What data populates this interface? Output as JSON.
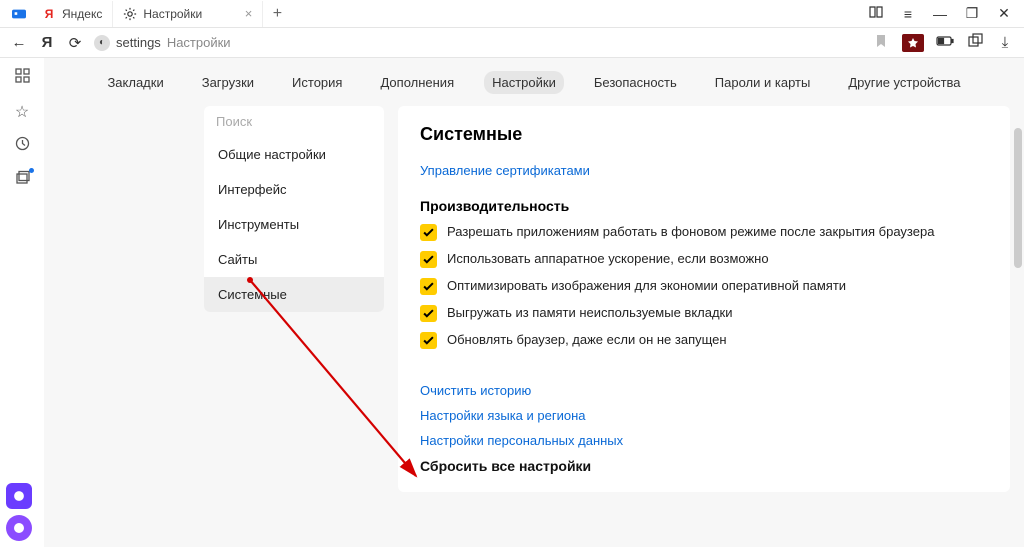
{
  "tabs": [
    {
      "label": "Яндекс",
      "icon": "Я",
      "icon_color": "#e52620"
    },
    {
      "label": "Настройки",
      "icon": "gear"
    }
  ],
  "window_controls": {
    "reader": "⧁",
    "menu": "≡",
    "min": "—",
    "max": "❐",
    "close": "✕"
  },
  "toolbar": {
    "back": "←",
    "home_letter": "Я",
    "reload": "⟳",
    "lock_icon": "◐",
    "addr_prefix": "settings",
    "addr_rest": "Настройки",
    "bookmark": "⚑",
    "battery": "▭",
    "ext": "⧉",
    "download": "⤓"
  },
  "leftrail": [
    "⊞",
    "☆",
    "◷",
    "⧉"
  ],
  "subnav": [
    "Закладки",
    "Загрузки",
    "История",
    "Дополнения",
    "Настройки",
    "Безопасность",
    "Пароли и карты",
    "Другие устройства"
  ],
  "subnav_active": 4,
  "sidebar": {
    "search_placeholder": "Поиск",
    "items": [
      "Общие настройки",
      "Интерфейс",
      "Инструменты",
      "Сайты",
      "Системные"
    ],
    "active": 4
  },
  "main": {
    "title": "Системные",
    "link_cert": "Управление сертификатами",
    "perf_title": "Производительность",
    "checks": [
      "Разрешать приложениям работать в фоновом режиме после закрытия браузера",
      "Использовать аппаратное ускорение, если возможно",
      "Оптимизировать изображения для экономии оперативной памяти",
      "Выгружать из памяти неиспользуемые вкладки",
      "Обновлять браузер, даже если он не запущен"
    ],
    "links2": [
      "Очистить историю",
      "Настройки языка и региона",
      "Настройки персональных данных"
    ],
    "reset": "Сбросить все настройки"
  }
}
